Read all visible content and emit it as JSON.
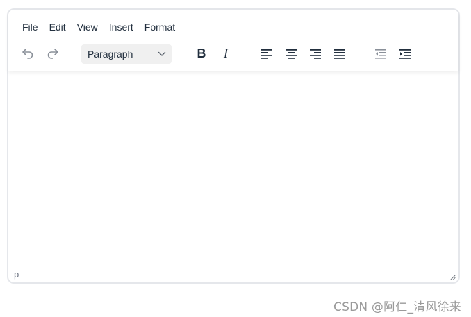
{
  "menubar": {
    "items": [
      {
        "label": "File"
      },
      {
        "label": "Edit"
      },
      {
        "label": "View"
      },
      {
        "label": "Insert"
      },
      {
        "label": "Format"
      }
    ]
  },
  "toolbar": {
    "undo_icon": "undo-icon",
    "redo_icon": "redo-icon",
    "block_format": {
      "selected": "Paragraph"
    },
    "bold_icon": "bold-icon",
    "italic_icon": "italic-icon",
    "align_left_icon": "align-left-icon",
    "align_center_icon": "align-center-icon",
    "align_right_icon": "align-right-icon",
    "align_justify_icon": "align-justify-icon",
    "outdent_icon": "outdent-icon",
    "indent_icon": "indent-icon"
  },
  "content": {
    "text": ""
  },
  "statusbar": {
    "path": "p"
  },
  "watermark": {
    "text": "CSDN @阿仁_清风徐来"
  },
  "colors": {
    "icon": "#222f3e",
    "icon_disabled": "#8a9099",
    "border": "#e5e7eb",
    "select_bg": "#f0f0f0"
  }
}
